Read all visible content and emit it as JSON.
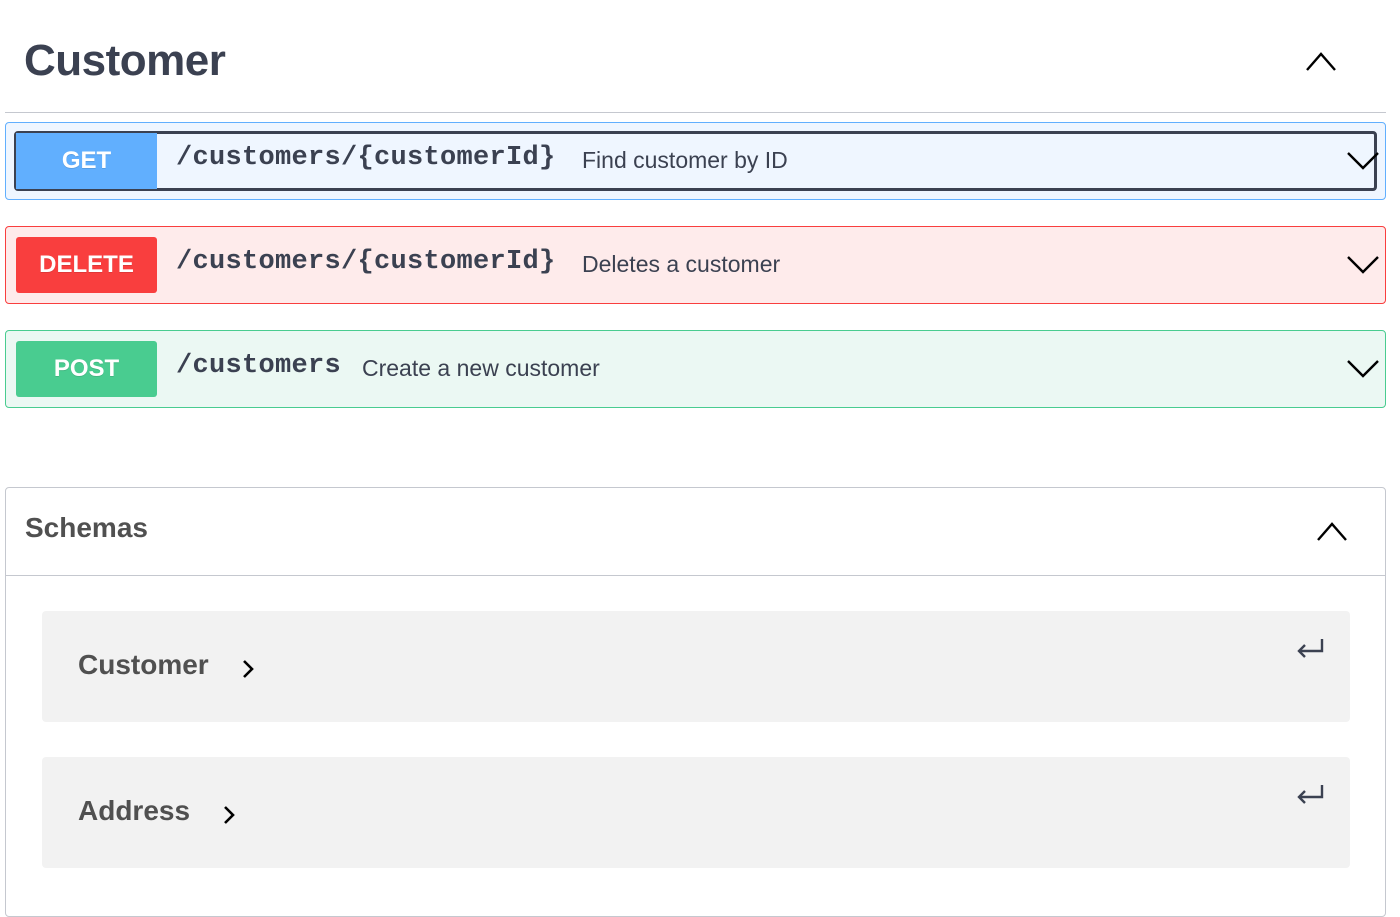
{
  "tag": {
    "title": "Customer",
    "toggle_icon": "chevron-up-icon"
  },
  "operations": [
    {
      "method": "GET",
      "path": "/customers/{customerId}",
      "summary": "Find customer by ID",
      "color": "#61affe",
      "focused": true
    },
    {
      "method": "DELETE",
      "path": "/customers/{customerId}",
      "summary": "Deletes a customer",
      "color": "#f93e3e"
    },
    {
      "method": "POST",
      "path": "/customers",
      "summary": "Create a new customer",
      "color": "#49cc90"
    }
  ],
  "schemas": {
    "title": "Schemas",
    "toggle_icon": "chevron-up-icon",
    "models": [
      {
        "name": "Customer",
        "expand_icon": "chevron-right-icon",
        "jump_icon": "return-arrow-icon"
      },
      {
        "name": "Address",
        "expand_icon": "chevron-right-icon",
        "jump_icon": "return-arrow-icon"
      }
    ]
  }
}
